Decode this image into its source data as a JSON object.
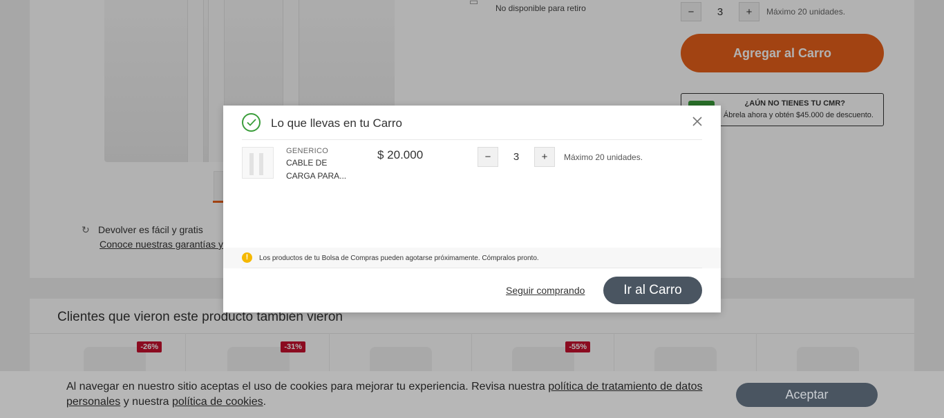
{
  "background": {
    "pickup_text": "No disponible para retiro",
    "return_text": "Devolver es fácil y gratis",
    "return_link": "Conoce nuestras garantías y derech",
    "stepper": {
      "minus": "−",
      "value": "3",
      "plus": "+",
      "max_label": "Máximo 20 unidades."
    },
    "add_to_cart": "Agregar al Carro",
    "cmr": {
      "title": "¿AÚN NO TIENES TU CMR?",
      "subtitle": "Ábrela ahora y obtén $45.000 de descuento."
    },
    "recommendations_title": "Clientes que vieron este producto también vieron",
    "badges": [
      "-26%",
      "-31%",
      "-55%"
    ]
  },
  "modal": {
    "title": "Lo que llevas en tu Carro",
    "item": {
      "brand": "GENERICO",
      "name": "CABLE DE CARGA PARA...",
      "price": "$ 20.000",
      "minus": "−",
      "quantity": "3",
      "plus": "+",
      "max_label": "Máximo 20 unidades."
    },
    "warning": "Los productos de tu Bolsa de Compras pueden agotarse próximamente. Cómpralos pronto.",
    "continue_label": "Seguir comprando",
    "go_cart_label": "Ir al Carro"
  },
  "cookies": {
    "text_1": "Al navegar en nuestro sitio aceptas el uso de cookies para mejorar tu experiencia. Revisa nuestra ",
    "link_1": "política de tratamiento de datos personales",
    "text_2": " y nuestra ",
    "link_2": "política de cookies",
    "text_3": ".",
    "accept_label": "Aceptar"
  },
  "colors": {
    "accent": "#e8611a",
    "dark_button": "#4a5561",
    "success": "#3a9d3a",
    "warning": "#f5b800",
    "discount": "#c8102e"
  }
}
